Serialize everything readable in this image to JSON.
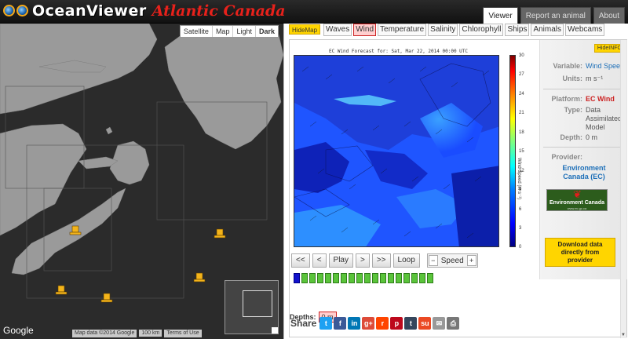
{
  "header": {
    "logo_main": "OceanViewer",
    "logo_sub": "Atlantic Canada",
    "tabs": [
      {
        "label": "Viewer",
        "active": true
      },
      {
        "label": "Report an animal",
        "active": false
      },
      {
        "label": "About",
        "active": false
      }
    ]
  },
  "map": {
    "types": [
      "Satellite",
      "Map",
      "Light",
      "Dark"
    ],
    "active_type": "Dark",
    "google": "Google",
    "footer": {
      "attribution": "Map data ©2014 Google",
      "scale": "100 km",
      "terms": "Terms of Use"
    }
  },
  "panel": {
    "hidemap": "HideMap",
    "variable_tabs": [
      "Waves",
      "Wind",
      "Temperature",
      "Salinity",
      "Chlorophyll",
      "Ships",
      "Animals",
      "Webcams"
    ],
    "active_variable": "Wind",
    "plot": {
      "title": "EC Wind Forecast for: Sat, Mar 22, 2014 00:00 UTC",
      "colorbar_ticks": [
        "30",
        "27",
        "24",
        "21",
        "18",
        "15",
        "12",
        "9",
        "6",
        "3",
        "0"
      ],
      "colorbar_label": "Wind Speed (m s⁻¹)"
    },
    "controls": {
      "first": "<<",
      "prev": "<",
      "play": "Play",
      "next": ">",
      "last": ">>",
      "loop": "Loop",
      "speed_minus": "−",
      "speed": "Speed",
      "speed_plus": "+"
    },
    "timeline": {
      "frames": 18,
      "current": 0
    },
    "depths": {
      "label": "Depths:",
      "value": "0 m"
    },
    "share": {
      "label": "Share"
    },
    "info": {
      "hideinfo": "HideINFO",
      "variable_label": "Variable:",
      "variable_value": "Wind Speed",
      "units_label": "Units:",
      "units_value": "m s⁻¹",
      "platform_label": "Platform:",
      "platform_value": "EC Wind",
      "type_label": "Type:",
      "type_value": [
        "Data",
        "Assimilated",
        "Model"
      ],
      "depth_label": "Depth:",
      "depth_value": "0 m",
      "provider_label": "Provider:",
      "provider_value": [
        "Environment",
        "Canada (EC)"
      ],
      "ec_logo_text": "Environment Canada",
      "ec_logo_url": "www.ec.gc.ca",
      "download": [
        "Download data",
        "directly from",
        "provider"
      ]
    }
  },
  "colors": {
    "header_bg": "#1a1a1a",
    "logo_sub": "#e8211b",
    "accent_yellow": "#ffd500",
    "active_tab": "#ffcfcf",
    "map_bg": "#2b2b2b",
    "land": "#9a9a9a"
  }
}
